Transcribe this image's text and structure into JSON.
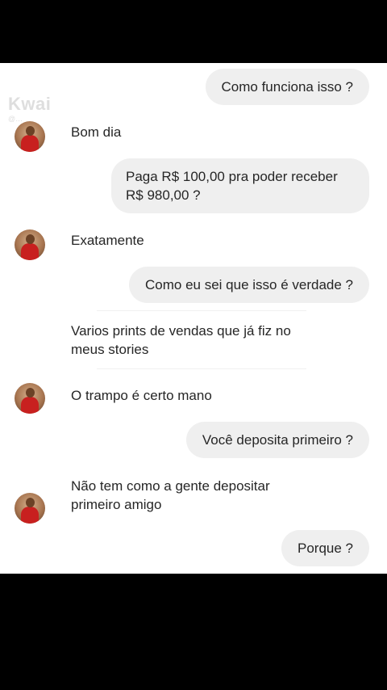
{
  "watermark": {
    "logo": "Kwai",
    "handle": "@…"
  },
  "messages": [
    {
      "from": "me",
      "text": "Como funciona isso ?"
    },
    {
      "from": "them",
      "text": "Bom dia"
    },
    {
      "from": "me",
      "line1": "Paga R$ 100,00 pra poder receber",
      "line2": "R$ 980,00 ?"
    },
    {
      "from": "them",
      "text": "Exatamente"
    },
    {
      "from": "me",
      "text": "Como eu sei que isso é verdade ?"
    },
    {
      "from": "them",
      "line1": "Varios prints de vendas que já fiz no",
      "line2": "meus stories"
    },
    {
      "from": "them",
      "text": "O trampo é certo mano"
    },
    {
      "from": "me",
      "text": "Você deposita primeiro ?"
    },
    {
      "from": "them",
      "line1": "Não tem como a gente depositar",
      "line2": "primeiro amigo"
    },
    {
      "from": "me",
      "text": "Porque ?"
    }
  ]
}
